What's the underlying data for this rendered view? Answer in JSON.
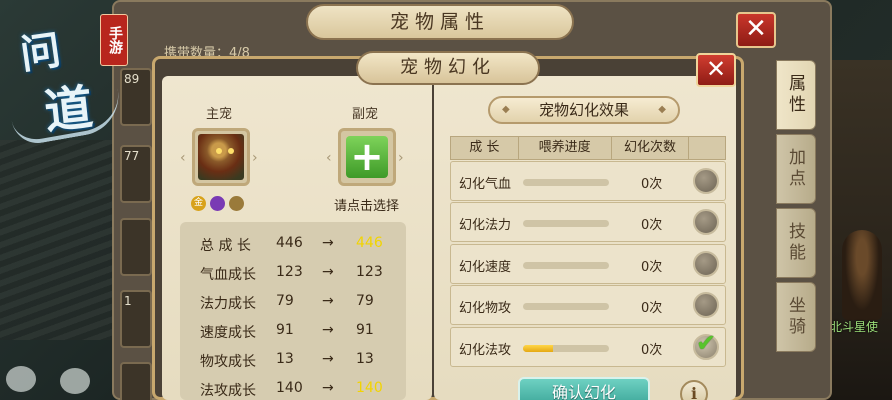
{
  "logo": {
    "glyph1": "问",
    "glyph2": "道",
    "badge": "手游"
  },
  "back_panel": {
    "title": "宠物属性",
    "close": "✕",
    "carry_count": "携带数量：4/8",
    "slots": [
      "89",
      "77",
      "",
      "1",
      ""
    ],
    "side_tabs": [
      "属性",
      "加点",
      "技能",
      "坐骑"
    ],
    "npc_label": "北斗星使"
  },
  "dialog": {
    "title": "宠物幻化",
    "close": "✕",
    "main_label": "主宠",
    "sub_label": "副宠",
    "plus": "+",
    "hint": "请点击选择",
    "mini_icons": [
      "金",
      "",
      ""
    ],
    "stats": [
      {
        "label": "总 成 长",
        "before": "446",
        "arrow": "→",
        "after": "446",
        "changed": true
      },
      {
        "label": "气血成长",
        "before": "123",
        "arrow": "→",
        "after": "123",
        "changed": false
      },
      {
        "label": "法力成长",
        "before": "79",
        "arrow": "→",
        "after": "79",
        "changed": false
      },
      {
        "label": "速度成长",
        "before": "91",
        "arrow": "→",
        "after": "91",
        "changed": false
      },
      {
        "label": "物攻成长",
        "before": "13",
        "arrow": "→",
        "after": "13",
        "changed": false
      },
      {
        "label": "法攻成长",
        "before": "140",
        "arrow": "→",
        "after": "140",
        "changed": true
      }
    ],
    "effect_title": "宠物幻化效果",
    "table_headers": [
      "成 长",
      "喂养进度",
      "幻化次数"
    ],
    "rows": [
      {
        "name": "幻化气血",
        "progress": 0,
        "count": "0次",
        "checked": false
      },
      {
        "name": "幻化法力",
        "progress": 0,
        "count": "0次",
        "checked": false
      },
      {
        "name": "幻化速度",
        "progress": 0,
        "count": "0次",
        "checked": false
      },
      {
        "name": "幻化物攻",
        "progress": 0,
        "count": "0次",
        "checked": false
      },
      {
        "name": "幻化法攻",
        "progress": 0.35,
        "count": "0次",
        "checked": true
      }
    ],
    "confirm": "确认幻化",
    "info": "i"
  },
  "colors": {
    "highlight": "#f2d400",
    "confirm": "#3aa497",
    "close": "#c9362b"
  }
}
